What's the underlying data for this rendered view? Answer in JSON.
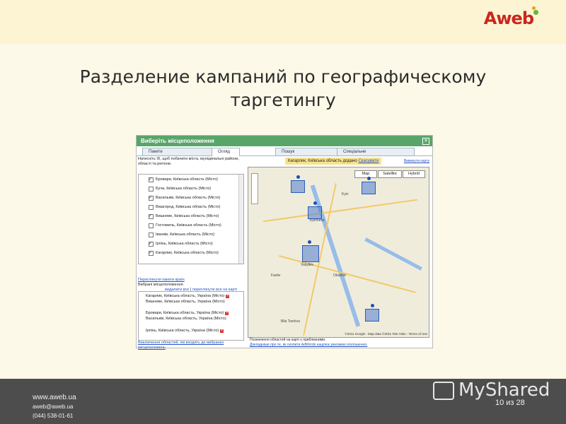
{
  "brand": {
    "logo_text": "Aweb"
  },
  "slide": {
    "title_line1": "Разделение кампаний по географическому",
    "title_line2": "таргетингу"
  },
  "dialog": {
    "title": "Виберіть місцеположення",
    "tabs": [
      "Пакети",
      "Огляд",
      "Пошук",
      "Спеціальне"
    ],
    "hint": "Натисніть ☒, щоб побачити міста, муніципальні райони, області та регіони.",
    "list_items": [
      {
        "label": "Бровари, Київська область (Місто)",
        "checked": true
      },
      {
        "label": "Буча, Київська область (Місто)",
        "checked": false
      },
      {
        "label": "Васильків, Київська область (Місто)",
        "checked": true
      },
      {
        "label": "Вишгород, Київська область (Місто)",
        "checked": false
      },
      {
        "label": "Вишневе, Київська область (Місто)",
        "checked": true
      },
      {
        "label": "Гостомель, Київська область (Місто)",
        "checked": false
      },
      {
        "label": "Іванків, Київська область (Місто)",
        "checked": false
      },
      {
        "label": "Ірпінь, Київська область (Місто)",
        "checked": true
      },
      {
        "label": "Кагарлик, Київська область (Місто)",
        "checked": true
      }
    ],
    "review_link": "Переглянути пакети країн",
    "selected_header": "Вибрані місцеположення",
    "remove_all": "видалити все",
    "view_all_map": "переглянути все на карті",
    "selected_items": [
      "Кагарлик, Київська область, Україна (Місто)",
      "Вишневе, Київська область, Україна (Місто)",
      "Бровари, Київська область, Україна (Місто)",
      "Васильків, Київська область, Україна (Місто)",
      "Ірпінь, Київська область, Україна (Місто)"
    ],
    "exclude_link": "Виключення областей, які входять до вибраних місцеположень",
    "notice": "Кагарлик, Київська область додано",
    "undo": "Скасувати",
    "map_buttons": [
      "Map",
      "Satellite",
      "Hybrid"
    ],
    "map_footer1": "Позначення областей на карті є приблизними.",
    "map_footer2": "Докладніше про те, як охопити AdWords націлює рекламні оголошення.",
    "copyright": "©2011 Google - Map data ©2011 Tele Atlas - Terms of Use",
    "clear_link": "Вимкнути карту",
    "towns": [
      "Kyiv",
      "Vyshneve",
      "Vasylkiv",
      "Obukhiv",
      "Fastiv",
      "Bila Tserkva"
    ]
  },
  "footer": {
    "site": "www.aweb.ua",
    "email": "aweb@aweb.ua",
    "phone": "(044) 538-01-61",
    "watermark": "MyShared",
    "page": "10 из 28"
  }
}
